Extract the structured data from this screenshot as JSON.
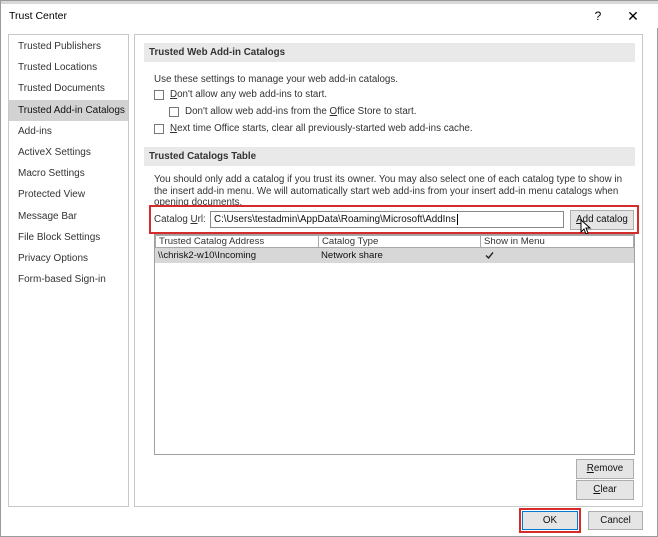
{
  "window": {
    "title": "Trust Center",
    "help_glyph": "?",
    "close_glyph": "✕"
  },
  "sidebar": {
    "items": [
      {
        "label": "Trusted Publishers",
        "selected": false
      },
      {
        "label": "Trusted Locations",
        "selected": false
      },
      {
        "label": "Trusted Documents",
        "selected": false
      },
      {
        "label": "Trusted Add-in Catalogs",
        "selected": true
      },
      {
        "label": "Add-ins",
        "selected": false
      },
      {
        "label": "ActiveX Settings",
        "selected": false
      },
      {
        "label": "Macro Settings",
        "selected": false
      },
      {
        "label": "Protected View",
        "selected": false
      },
      {
        "label": "Message Bar",
        "selected": false
      },
      {
        "label": "File Block Settings",
        "selected": false
      },
      {
        "label": "Privacy Options",
        "selected": false
      },
      {
        "label": "Form-based Sign-in",
        "selected": false
      }
    ]
  },
  "web_catalogs": {
    "header": "Trusted Web Add-in Catalogs",
    "intro": "Use these settings to manage your web add-in catalogs.",
    "options": [
      {
        "pre": "",
        "accel": "D",
        "post": "on't allow any web add-ins to start.",
        "checked": false
      },
      {
        "pre": "Don't allow web add-ins from the ",
        "accel": "O",
        "post": "ffice Store to start.",
        "checked": false
      },
      {
        "pre": "",
        "accel": "N",
        "post": "ext time Office starts, clear all previously-started web add-ins cache.",
        "checked": false
      }
    ]
  },
  "catalogs_table": {
    "header": "Trusted Catalogs Table",
    "paragraph": "You should only add a catalog if you trust its owner. You may also select one of each catalog type to show in the insert add-in menu. We will automatically start web add-ins from your insert add-in menu catalogs when opening documents.",
    "url_label_pre": "Catalog ",
    "url_label_accel": "U",
    "url_label_post": "rl:",
    "url_value": "C:\\Users\\testadmin\\AppData\\Roaming\\Microsoft\\AddIns",
    "add_button_accel": "A",
    "add_button_rest": "dd catalog",
    "columns": [
      "Trusted Catalog Address",
      "Catalog Type",
      "Show in Menu"
    ],
    "rows": [
      {
        "address": "\\\\chrisk2-w10\\Incoming",
        "type": "Network share",
        "show_in_menu": true
      }
    ]
  },
  "buttons": {
    "remove_accel": "R",
    "remove_rest": "emove",
    "clear_accel": "C",
    "clear_rest": "lear",
    "ok": "OK",
    "cancel": "Cancel"
  },
  "colors": {
    "highlight_border": "#d62b2b",
    "selected_item_bg": "#d2d2d2",
    "section_header_bg": "#e9e9e9"
  }
}
